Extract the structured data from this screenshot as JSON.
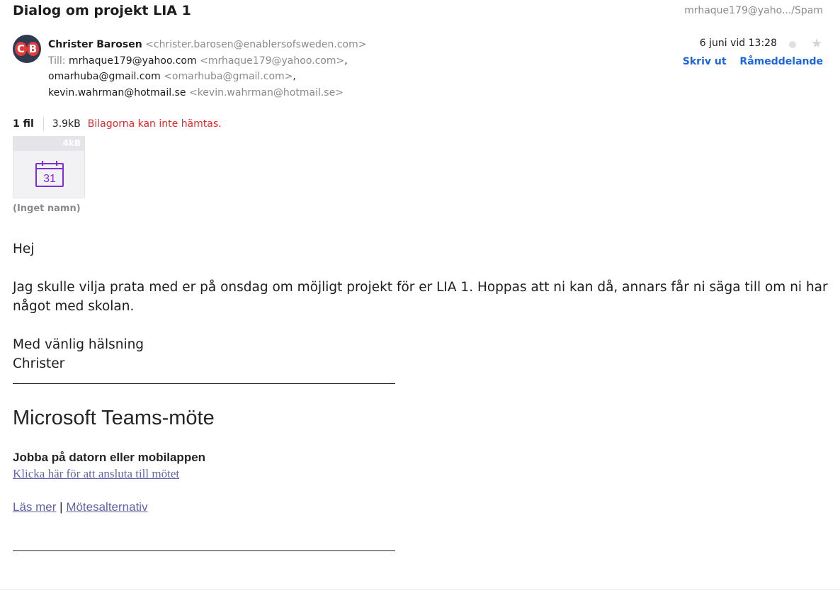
{
  "email": {
    "subject": "Dialog om projekt LIA 1",
    "folder": "mrhaque179@yaho.../Spam",
    "sender": {
      "avatar_initials": [
        "C",
        "B"
      ],
      "name": "Christer Barosen",
      "email": "<christer.barosen@enablersofsweden.com>"
    },
    "to_label": "Till:",
    "recipients": [
      {
        "name": "mrhaque179@yahoo.com",
        "email": "<mrhaque179@yahoo.com>",
        "suffix": ","
      },
      {
        "name": "omarhuba@gmail.com",
        "email": "<omarhuba@gmail.com>",
        "suffix": ","
      },
      {
        "name": "kevin.wahrman@hotmail.se",
        "email": "<kevin.wahrman@hotmail.se>",
        "suffix": ""
      }
    ],
    "date": "6 juni vid 13:28",
    "actions": {
      "print": "Skriv ut",
      "raw": "Råmeddelande"
    },
    "star_icon": "star-icon"
  },
  "attachments": {
    "count": "1 fil",
    "total_size": "3.9kB",
    "error": "Bilagorna kan inte hämtas.",
    "items": [
      {
        "size": "4kB",
        "icon": "calendar-icon",
        "calendar_day": "31",
        "name": "(Inget namn)"
      }
    ]
  },
  "body": {
    "greeting": "Hej",
    "paragraph": "Jag skulle vilja prata med er på onsdag om möjligt projekt för er LIA 1. Hoppas att ni kan då, annars får ni säga till om ni har något med skolan.",
    "closing": "Med vänlig hälsning",
    "signature": "Christer",
    "teams": {
      "title": "Microsoft Teams-möte",
      "subheading": "Jobba på datorn eller mobilappen",
      "join_link": "Klicka här för att ansluta till mötet",
      "learn_more": "Läs mer",
      "separator": "|",
      "options": "Mötesalternativ"
    }
  },
  "colors": {
    "link": "#1a66e0",
    "error": "#e02b2b",
    "teams_link": "#6264a7",
    "avatar_accent": "#e23b3b"
  }
}
